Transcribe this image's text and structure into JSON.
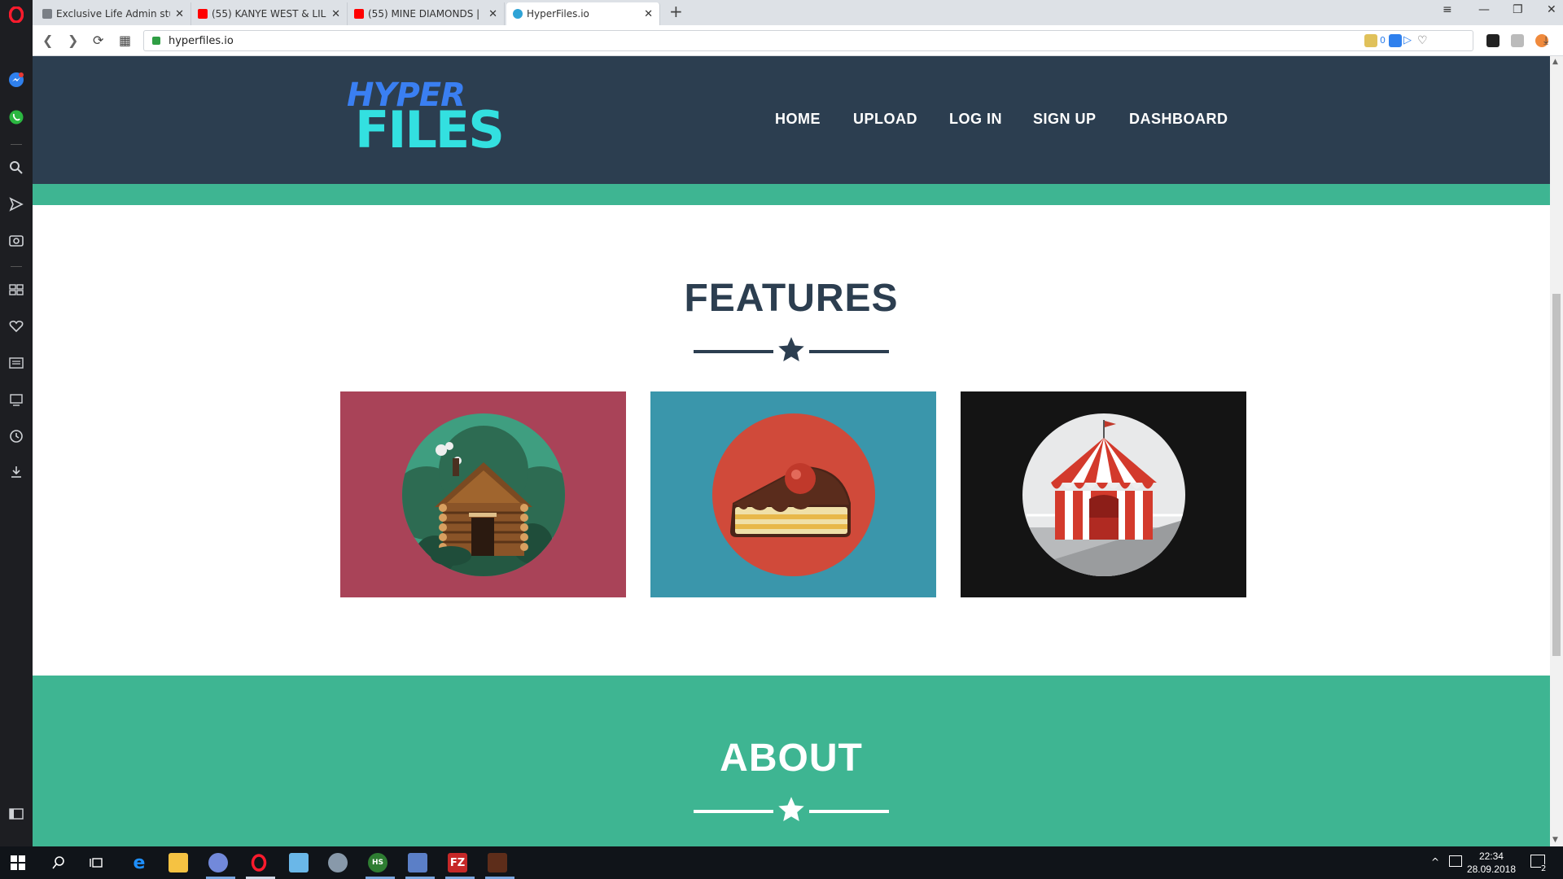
{
  "browser": {
    "tabs": [
      {
        "title": "Exclusive Life Admin stuff",
        "icon": "document-icon"
      },
      {
        "title": "(55) KANYE WEST & LIL PUMP",
        "icon": "youtube-icon"
      },
      {
        "title": "(55) MINE DIAMONDS | mi",
        "icon": "youtube-icon"
      },
      {
        "title": "HyperFiles.io",
        "icon": "globe-icon"
      }
    ],
    "url": "hyperfiles.io",
    "extension_badge": "0"
  },
  "site": {
    "logo_top": "HYPER",
    "logo_bottom": "FILES",
    "nav": [
      "HOME",
      "UPLOAD",
      "LOG IN",
      "SIGN UP",
      "DASHBOARD"
    ],
    "features_title": "FEATURES",
    "about_title": "ABOUT",
    "cards": [
      {
        "name": "log-cabin",
        "bg": "#a94358"
      },
      {
        "name": "cake-slice",
        "bg": "#3a96ab"
      },
      {
        "name": "circus-tent",
        "bg": "#141414"
      }
    ],
    "colors": {
      "header": "#2c3e50",
      "accent_green": "#3eb592"
    }
  },
  "taskbar": {
    "time": "22:34",
    "date": "28.09.2018",
    "notification_count": "2"
  }
}
